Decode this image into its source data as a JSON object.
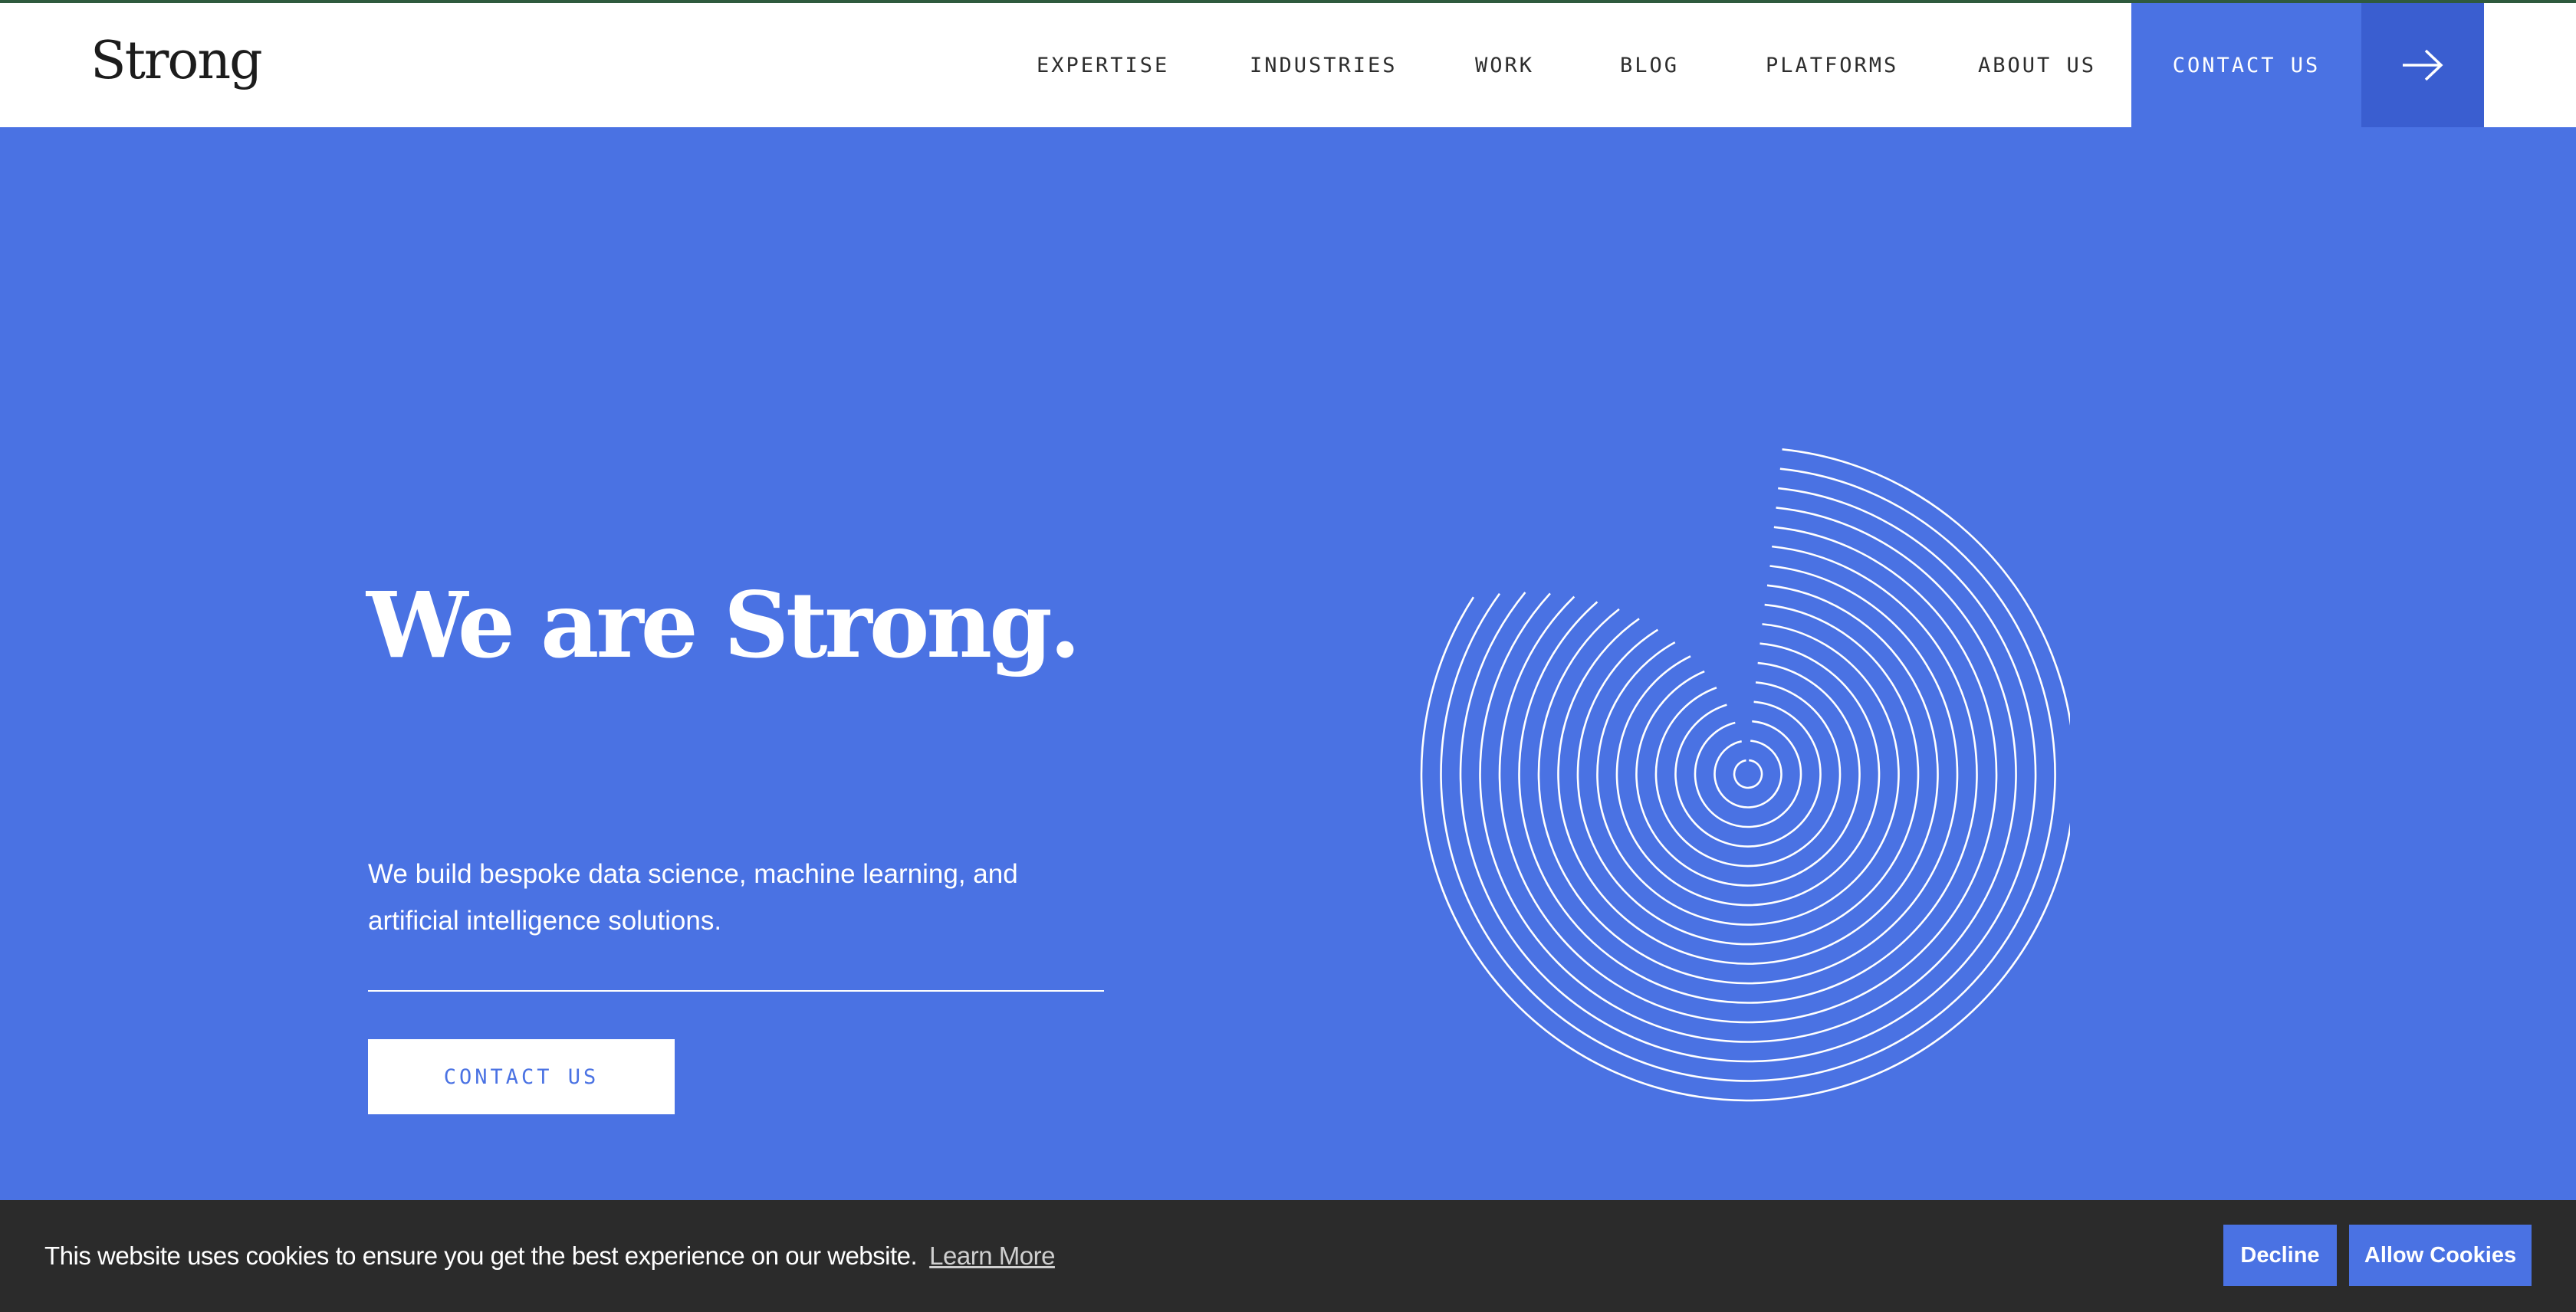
{
  "brand": {
    "logo_text": "Strong"
  },
  "nav": {
    "items": [
      {
        "label": "EXPERTISE"
      },
      {
        "label": "INDUSTRIES"
      },
      {
        "label": "WORK"
      },
      {
        "label": "BLOG"
      },
      {
        "label": "PLATFORMS"
      },
      {
        "label": "ABOUT US"
      }
    ],
    "cta_label": "CONTACT US",
    "cta_icon": "arrow-right-icon"
  },
  "hero": {
    "title": "We are Strong.",
    "subtitle": "We build bespoke data science, machine learning, and artificial intelligence solutions.",
    "button_label": "CONTACT US",
    "graphic": "concentric-arcs-graphic"
  },
  "cookie_banner": {
    "message": "This website uses cookies to ensure you get the best experience on our website.",
    "learn_more": "Learn More",
    "decline": "Decline",
    "allow": "Allow Cookies"
  },
  "colors": {
    "accent": "#4a72e3",
    "accent_dark": "#3a5ed0",
    "header_bg": "#ffffff",
    "cookie_bg": "#2b2b2b",
    "text_dark": "#2d2d2d"
  }
}
